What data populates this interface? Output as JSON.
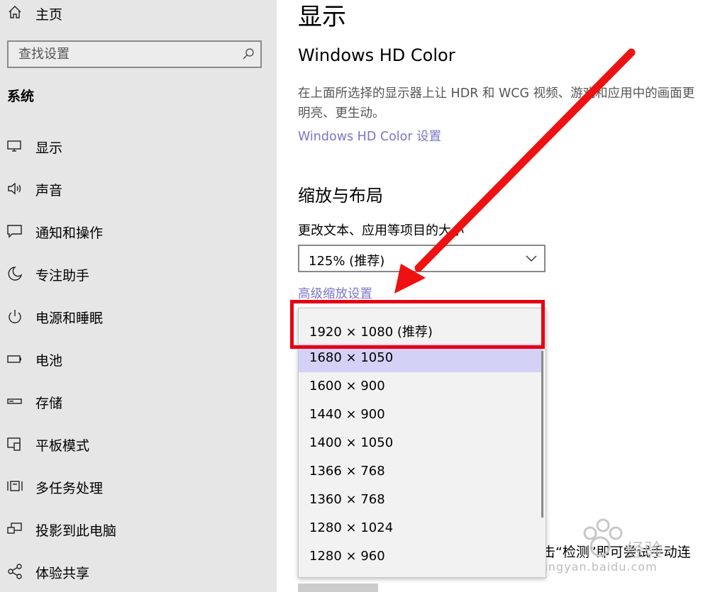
{
  "sidebar": {
    "home_label": "主页",
    "search_placeholder": "查找设置",
    "section_title": "系统",
    "items": [
      {
        "label": "显示",
        "icon": "monitor-icon"
      },
      {
        "label": "声音",
        "icon": "speaker-icon"
      },
      {
        "label": "通知和操作",
        "icon": "notification-icon"
      },
      {
        "label": "专注助手",
        "icon": "moon-icon"
      },
      {
        "label": "电源和睡眠",
        "icon": "power-icon"
      },
      {
        "label": "电池",
        "icon": "battery-icon"
      },
      {
        "label": "存储",
        "icon": "storage-icon"
      },
      {
        "label": "平板模式",
        "icon": "tablet-icon"
      },
      {
        "label": "多任务处理",
        "icon": "multitask-icon"
      },
      {
        "label": "投影到此电脑",
        "icon": "project-icon"
      },
      {
        "label": "体验共享",
        "icon": "share-icon"
      }
    ]
  },
  "main": {
    "page_title": "显示",
    "hdr_title": "Windows HD Color",
    "hdr_desc": "在上面所选择的显示器上让 HDR 和 WCG 视频、游戏和应用中的画面更明亮、更生动。",
    "hdr_link": "Windows HD Color 设置",
    "scale_title": "缩放与布局",
    "scale_label": "更改文本、应用等项目的大小",
    "scale_value": "125% (推荐)",
    "advanced_link": "高级缩放设置",
    "partial_text": "击“检测”即可尝试手动连"
  },
  "dropdown": {
    "options": [
      "1920 × 1080 (推荐)",
      "1680 × 1050",
      "1600 × 900",
      "1440 × 900",
      "1400 × 1050",
      "1366 × 768",
      "1360 × 768",
      "1280 × 1024",
      "1280 × 960"
    ],
    "selected_index": 1
  },
  "watermark": {
    "text": "Bai 经验",
    "domain": "jingyan.baidu.com"
  },
  "colors": {
    "accent": "#7a76c6",
    "selected": "#d4d1f7",
    "annotation": "#e60012",
    "sidebar_bg": "#e6e6e6"
  }
}
